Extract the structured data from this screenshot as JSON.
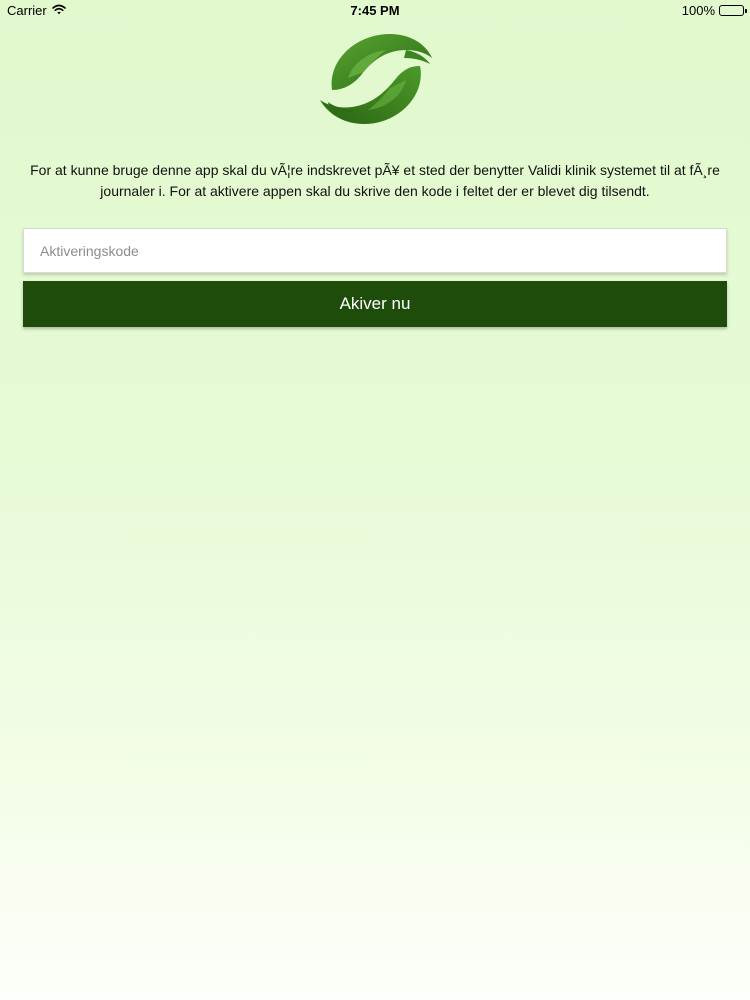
{
  "status_bar": {
    "carrier": "Carrier",
    "time": "7:45 PM",
    "battery": "100%",
    "battery_level": 1.0,
    "icons": [
      "wifi-icon",
      "battery-icon"
    ]
  },
  "logo": {
    "icon": "hands-leaf-logo",
    "colors": [
      "#3d8a22",
      "#4f9e2d",
      "#2f6e17"
    ]
  },
  "description": "For at kunne bruge denne app skal du vÃ¦re indskrevet pÃ¥ et sted der benytter Validi klinik systemet til at fÃ¸re journaler i. For at aktivere appen skal du skrive den kode i feltet der er blevet dig tilsendt.",
  "form": {
    "code_placeholder": "Aktiveringskode",
    "code_value": "",
    "submit_label": "Akiver nu"
  },
  "colors": {
    "background": "#e1f9cd",
    "button": "#1e4d0b",
    "button_text": "#ffffff"
  }
}
